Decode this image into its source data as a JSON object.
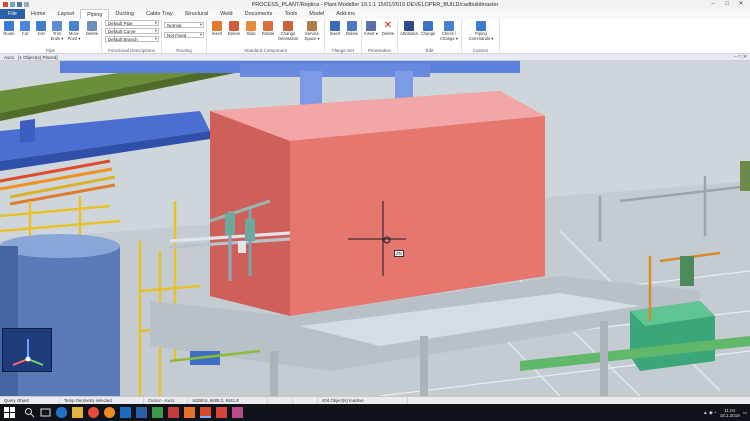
{
  "titlebar": {
    "title": "PROCESS_PLANT/Replica - Plant Modeller 19.1.1 15/01/2019 DEVELOPER_BUILD/cadbuildmaster",
    "min": "–",
    "max": "□",
    "close": "✕"
  },
  "tabs": [
    {
      "label": "File"
    },
    {
      "label": "Home"
    },
    {
      "label": "Layout"
    },
    {
      "label": "Piping"
    },
    {
      "label": "Ducting"
    },
    {
      "label": "Cable Tray"
    },
    {
      "label": "Structural"
    },
    {
      "label": "Weld"
    },
    {
      "label": "Documents"
    },
    {
      "label": "Tools"
    },
    {
      "label": "Model"
    },
    {
      "label": "Add-ins"
    }
  ],
  "ribbon": {
    "pipe_group": {
      "label": "Pipe",
      "buttons": [
        "Route",
        "Cut",
        "Join",
        "Trim Ends ▾",
        "Move Point ▾",
        "Delete"
      ]
    },
    "spec_group": {
      "label": "Functional Descriptions",
      "combos": [
        "Default Pipe",
        "Default Curve",
        "Default Branch"
      ]
    },
    "routing_group": {
      "label": "Routing",
      "combos": [
        "Normal",
        "Not Fixed"
      ]
    },
    "std_group": {
      "label": "Standard Component",
      "buttons": [
        "Insert",
        "Delete",
        "Slide",
        "Rotate",
        "Change Orientation",
        "Service Space ▾"
      ]
    },
    "flange_group": {
      "label": "Flange Set",
      "buttons": [
        "Insert",
        "Delete"
      ]
    },
    "penetration_group": {
      "label": "Penetration",
      "buttons": [
        "Insert ▾",
        "Delete"
      ]
    },
    "edit_group": {
      "label": "Edit",
      "buttons": [
        "Attributes",
        "Change",
        "Check / Change ▾"
      ]
    },
    "custom_group": {
      "label": "Custom",
      "buttons": [
        "Piping Commands ▾"
      ]
    }
  },
  "viewport": {
    "tab_label": "Axo1",
    "info": "[1 Object(s) Placed]",
    "cursor_tag": "ZN",
    "controls": "– □ ✕"
  },
  "statusbar": {
    "cells": [
      "Query Object",
      "Temp Geometry selected",
      "Cursor - Axo1",
      "16290.8, 6608.3, 8441.8",
      "",
      "",
      "404 Object(s) Inactive"
    ]
  },
  "taskbar": {
    "time": "11:04",
    "date": "18.1.2019"
  },
  "colors": {
    "file_tab": "#2b5fa8",
    "tank_box": "#e5776e",
    "duct": "#4a6fd0",
    "beam": "#6b8e3a",
    "steel_yellow": "#e6c12b",
    "ground": "#c9d1d6",
    "taskbar": "#10131a"
  }
}
